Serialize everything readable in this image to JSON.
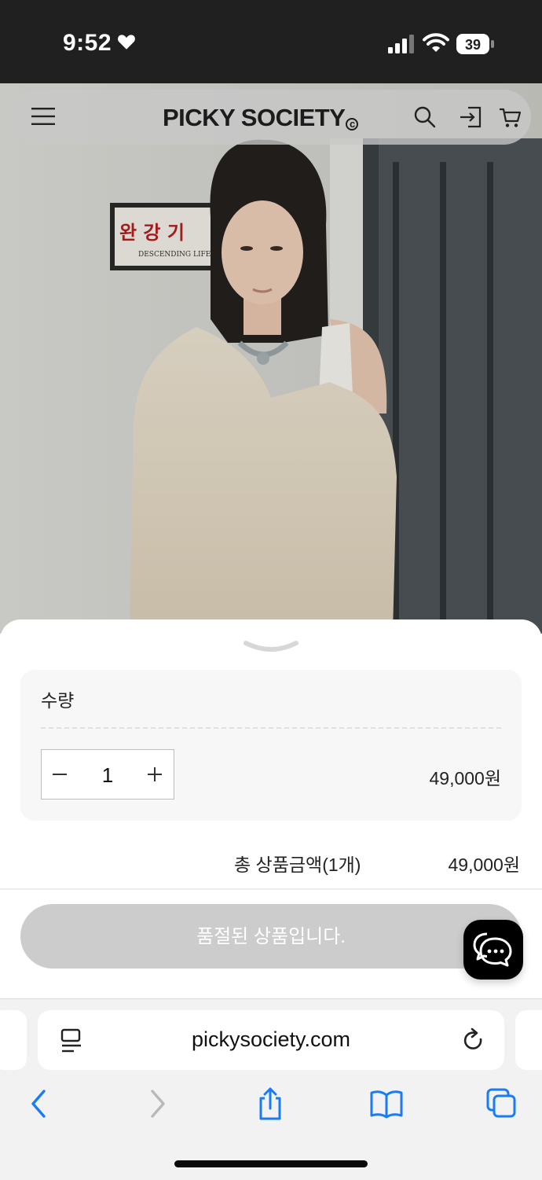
{
  "status_bar": {
    "time": "9:52",
    "battery": "39"
  },
  "site": {
    "logo": "PICKY SOCIETY",
    "logo_mark": "c",
    "icons": [
      "menu-icon",
      "search-icon",
      "login-icon",
      "cart-icon"
    ]
  },
  "hero_sign": "완 강 기",
  "hero_sign_sub": "DESCENDING LIFE LINE",
  "order": {
    "quantity_label": "수량",
    "quantity": "1",
    "item_price": "49,000원",
    "total_label": "총 상품금액(1개)",
    "total_price": "49,000원",
    "soldout_button": "품절된 상품입니다."
  },
  "browser": {
    "url": "pickysociety.com",
    "toolbar_icons": [
      "back-icon",
      "forward-icon",
      "share-icon",
      "bookmarks-icon",
      "tabs-icon"
    ]
  },
  "colors": {
    "accent_blue": "#1a7cf5",
    "soldout_gray": "#cccccc",
    "chat_black": "#000000"
  }
}
